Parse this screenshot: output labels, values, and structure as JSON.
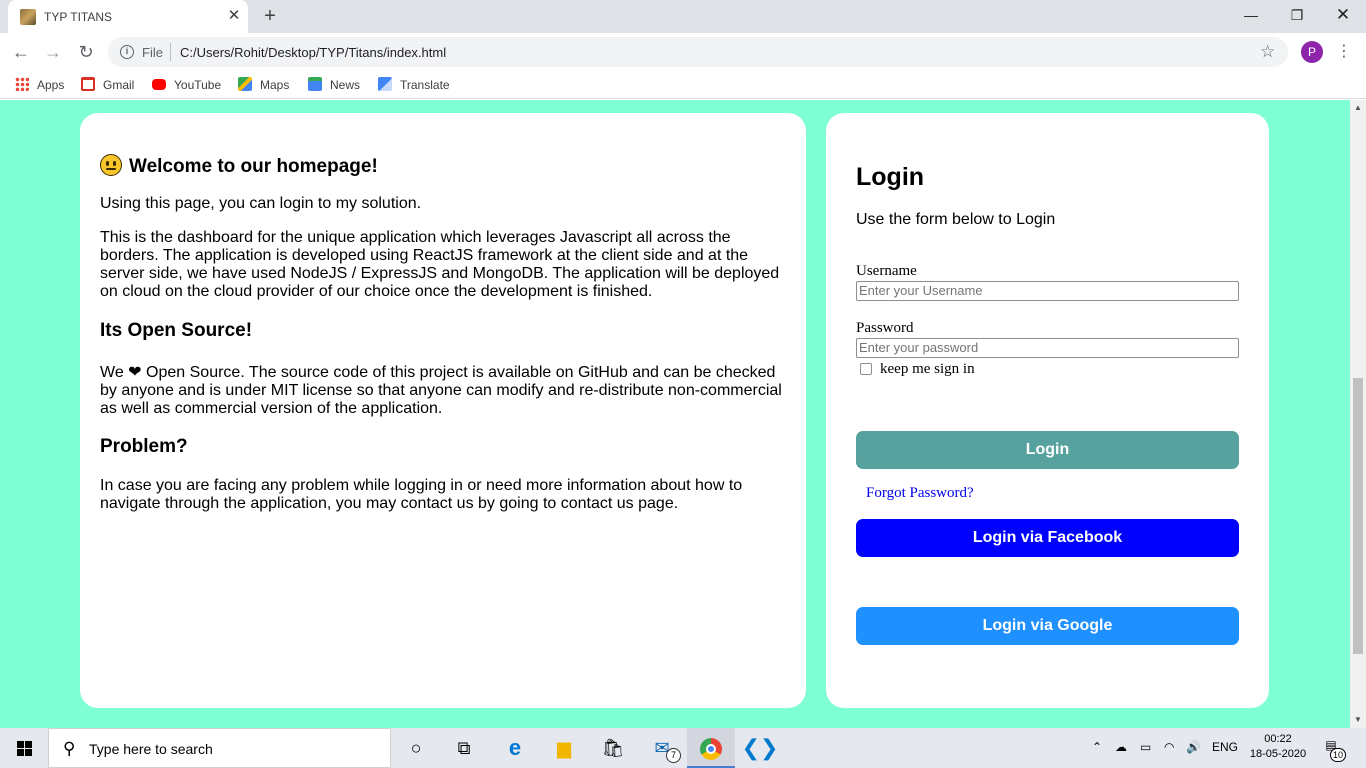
{
  "browser": {
    "tab_title": "TYP TITANS",
    "tab_close": "✕",
    "new_tab": "+",
    "url_scheme": "File",
    "url": "C:/Users/Rohit/Desktop/TYP/Titans/index.html",
    "profile_initial": "P",
    "window_controls": {
      "minimize": "—",
      "restore": "❐",
      "close": "✕"
    },
    "nav": {
      "back": "←",
      "forward": "→",
      "reload": "↻"
    },
    "bookmarks": [
      {
        "label": "Apps",
        "icon": "apps-grid-icon",
        "color": "#ea4335"
      },
      {
        "label": "Gmail",
        "icon": "gmail-icon",
        "color": "#d93025"
      },
      {
        "label": "YouTube",
        "icon": "youtube-icon",
        "color": "#ff0000"
      },
      {
        "label": "Maps",
        "icon": "maps-icon",
        "color": "#34a853"
      },
      {
        "label": "News",
        "icon": "news-icon",
        "color": "#4285f4"
      },
      {
        "label": "Translate",
        "icon": "translate-icon",
        "color": "#4285f4"
      }
    ]
  },
  "page": {
    "background": "#7fffd4",
    "welcome": {
      "heading": "Welcome to our homepage!",
      "intro": "Using this page, you can login to my solution.",
      "body": "This is the dashboard for the unique application which leverages Javascript all across the borders. The application is developed using ReactJS framework at the client side and at the server side, we have used NodeJS / ExpressJS and MongoDB. The application will be deployed on cloud on the cloud provider of our choice once the development is finished."
    },
    "open_source": {
      "heading": "Its Open Source!",
      "body_prefix": "We",
      "body": "Open Source. The source code of this project is available on GitHub and can be checked by anyone and is under MIT license so that anyone can modify and re-distribute non-commercial as well as commercial version of the application."
    },
    "problem": {
      "heading": "Problem?",
      "body": "In case you are facing any problem while logging in or need more information about how to navigate through the application, you may contact us by going to contact us page."
    },
    "login": {
      "title": "Login",
      "subtitle": "Use the form below to Login",
      "username_label": "Username",
      "username_placeholder": "Enter your Username",
      "password_label": "Password",
      "password_placeholder": "Enter your password",
      "remember_label": "keep me sign in",
      "login_button": "Login",
      "forgot_link": "Forgot Password?",
      "facebook_button": "Login via Facebook",
      "google_button": "Login via Google",
      "colors": {
        "login": "#57a19f",
        "facebook": "#0000ff",
        "google": "#1e90ff"
      }
    }
  },
  "taskbar": {
    "search_placeholder": "Type here to search",
    "language": "ENG",
    "time": "00:22",
    "date": "18-05-2020",
    "mail_badge": "7",
    "notification_count": "10"
  }
}
